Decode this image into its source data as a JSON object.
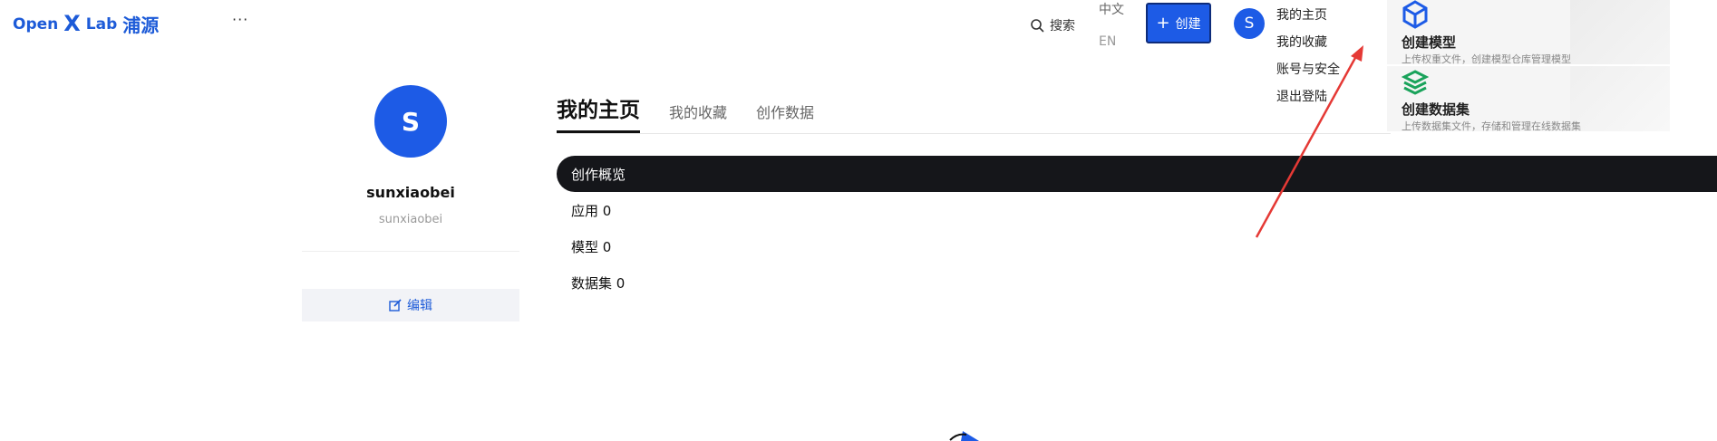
{
  "header": {
    "logo": {
      "open": "Open",
      "x": "X",
      "lab": "Lab",
      "cn": "浦源"
    },
    "more_label": "···",
    "search_label": "搜索",
    "lang_zh": "中文",
    "lang_en": "EN",
    "create_label": "创建",
    "avatar_initial": "S"
  },
  "user_menu": {
    "items": [
      "我的主页",
      "我的收藏",
      "账号与安全",
      "退出登陆"
    ]
  },
  "create_menu": {
    "model": {
      "title": "创建模型",
      "desc": "上传权重文件，创建模型仓库管理模型"
    },
    "dataset": {
      "title": "创建数据集",
      "desc": "上传数据集文件，存储和管理在线数据集"
    }
  },
  "profile": {
    "avatar_initial": "S",
    "username": "sunxiaobei",
    "handle": "sunxiaobei",
    "edit_label": "编辑"
  },
  "tabs": [
    "我的主页",
    "我的收藏",
    "创作数据"
  ],
  "overview": {
    "title": "创作概览",
    "items": [
      "应用 0",
      "模型 0",
      "数据集 0"
    ]
  },
  "colors": {
    "brand_blue": "#1d5be6",
    "overview_bg": "#15161a",
    "arrow_red": "#e53935",
    "dataset_icon_green": "#1aa35b"
  }
}
